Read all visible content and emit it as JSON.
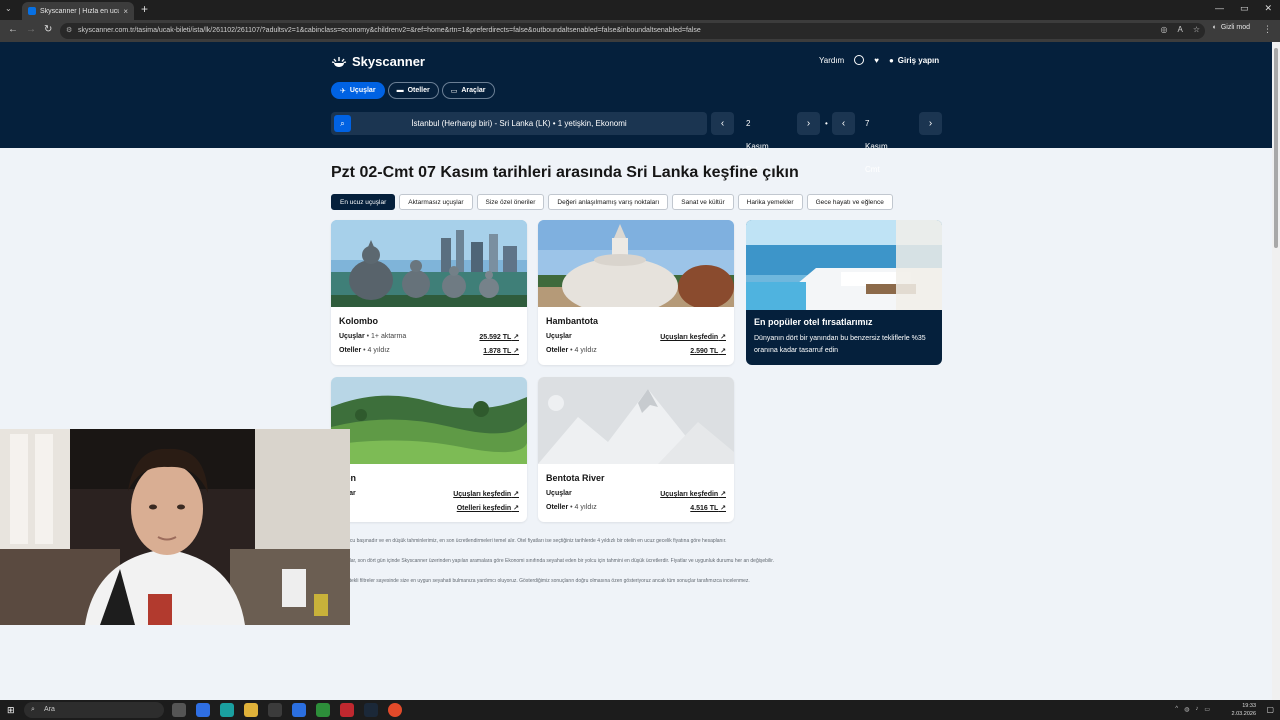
{
  "browser": {
    "tab_title": "Skyscanner | Hızla en ucuz uçak...",
    "tab_close": "×",
    "new_tab": "+",
    "url": "skyscanner.com.tr/tasima/ucak-bileti/ista/lk/261102/261107/?adultsv2=1&cabinclass=economy&childrenv2=&ref=home&rtn=1&preferdirects=false&outboundaltsenabled=false&inboundaltsenabled=false",
    "incognito_label": "Gizli mod",
    "window_buttons": [
      "—",
      "▭",
      "✕"
    ]
  },
  "header": {
    "logo": "Skyscanner",
    "help": "Yardım",
    "signin": "Giriş yapın",
    "tabs": [
      {
        "label": "Uçuşlar",
        "icon": "plane-icon",
        "active": true
      },
      {
        "label": "Oteller",
        "icon": "bed-icon",
        "active": false
      },
      {
        "label": "Araçlar",
        "icon": "car-icon",
        "active": false
      }
    ],
    "search_summary": "İstanbul (Herhangi biri) - Sri Lanka (LK)  •  1 yetişkin, Ekonomi",
    "depart_date": "2 Kasım Pzt",
    "return_date": "7 Kasım Cmt",
    "date_separator": "•"
  },
  "main": {
    "title": "Pzt 02-Cmt 07 Kasım tarihleri arasında Sri Lanka keşfine çıkın",
    "chips": [
      {
        "label": "En ucuz uçuşlar",
        "active": true
      },
      {
        "label": "Aktarmasız uçuşlar",
        "active": false
      },
      {
        "label": "Size özel öneriler",
        "active": false
      },
      {
        "label": "Değeri anlaşılmamış varış noktaları",
        "active": false
      },
      {
        "label": "Sanat ve kültür",
        "active": false
      },
      {
        "label": "Harika yemekler",
        "active": false
      },
      {
        "label": "Gece hayatı ve eğlence",
        "active": false
      }
    ],
    "cards": [
      {
        "name": "Kolombo",
        "flights_label": "Uçuşlar",
        "flights_note": " • 1+ aktarma",
        "flights_value": "25.592 TL",
        "hotels_label": "Oteller",
        "hotels_note": " • 4 yıldız",
        "hotels_value": "1.878 TL"
      },
      {
        "name": "Hambantota",
        "flights_label": "Uçuşlar",
        "flights_note": "",
        "flights_value": "Uçuşları keşfedin",
        "hotels_label": "Oteller",
        "hotels_note": " • 4 yıldız",
        "hotels_value": "2.590 TL"
      },
      {
        "name": "tton",
        "flights_label": "uşlar",
        "flights_note": "",
        "flights_value": "Uçuşları keşfedin",
        "hotels_label": "",
        "hotels_note": "",
        "hotels_value": "Otelleri keşfedin"
      },
      {
        "name": "Bentota River",
        "flights_label": "Uçuşlar",
        "flights_note": "",
        "flights_value": "Uçuşları keşfedin",
        "hotels_label": "Oteller",
        "hotels_note": " • 4 yıldız",
        "hotels_value": "4.516 TL"
      }
    ],
    "promo": {
      "title": "En popüler otel fırsatlarımız",
      "desc": "Dünyanın dört bir yanından bu benzersiz tekliflerle %35 oranına kadar tasarruf edin"
    },
    "footnotes": [
      "atları yolcu başınadır ve en düşük tahminlerimiz, en son ücretlendirmeleri temel alır. Otel fiyatları ise seçtiğiniz tarihlerde 4 yıldızlı bir otelin en ucuz gecelik fiyatına göre hesaplanır.",
      "tlen fiyatlar, son dört gün içinde Skyscanner üzerinden yapılan aramalara göre Ekonomi sınıfında seyahat eden bir yolcu için tahmini en düşük ücretlerdir. Fiyatlar ve uygunluk durumu her an değişebilir.",
      "kkat destekli filtreler sayesinde size en uygun seyahati bulmanıza yardımcı oluyoruz. Gösterdiğimiz sonuçların doğru olmasına özen gösteriyoruz ancak tüm sonuçlar tarafımızca incelenmez."
    ]
  },
  "taskbar": {
    "search_placeholder": "Ara",
    "time": "19:33",
    "date": "2.03.2026"
  },
  "colors": {
    "header_bg": "#05203c",
    "accent": "#0062e3",
    "page_bg": "#eff3f8"
  }
}
